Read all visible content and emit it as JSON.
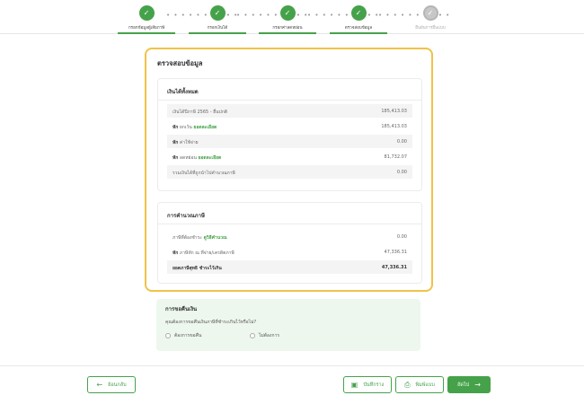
{
  "stepper": {
    "steps": [
      {
        "label": "กรอกข้อมูลผู้เสียภาษี",
        "status": "done"
      },
      {
        "label": "กรอกเงินได้",
        "status": "done"
      },
      {
        "label": "กรอกค่าลดหย่อน",
        "status": "done"
      },
      {
        "label": "ตรวจสอบข้อมูล",
        "status": "done"
      },
      {
        "label": "ยืนยันการยื่นแบบ",
        "status": "pending"
      }
    ],
    "separator": "• • • • • • • • • •"
  },
  "review": {
    "title": "ตรวจสอบข้อมูล",
    "income": {
      "title": "เงินได้ทั้งหมด",
      "rows": [
        {
          "label": "เงินได้ปีภาษี 2565 - ยื่นปกติ",
          "value": "185,413.03"
        },
        {
          "prefix": "หัก",
          "label": "ยกเว้น",
          "link": "ยอดละเอียด",
          "value": "185,413.03"
        },
        {
          "prefix": "หัก",
          "label": "ค่าใช้จ่าย",
          "value": "0.00"
        },
        {
          "prefix": "หัก",
          "label": "ลดหย่อน",
          "link": "ยอดละเอียด",
          "value": "81,732.07"
        },
        {
          "label": "รวมเงินได้ที่ถูกนำไปคำนวณภาษี",
          "value": "0.00"
        }
      ]
    },
    "tax": {
      "title": "การคำนวณภาษี",
      "rows": [
        {
          "label": "ภาษีที่ต้องชำระ",
          "link": "ดูวิธีคำนวณ",
          "value": "0.00"
        },
        {
          "prefix": "หัก",
          "label": "ภาษีหัก ณ ที่จ่าย/เครดิตภาษี",
          "value": "47,336.31"
        },
        {
          "label": "ยอดภาษีสุทธิ ชำระไว้เกิน",
          "value": "47,336.31"
        }
      ]
    }
  },
  "refund": {
    "title": "การขอคืนเงิน",
    "question": "คุณต้องการขอคืนเงินภาษีที่ชำระเกินไว้หรือไม่?",
    "options": [
      "ต้องการขอคืน",
      "ไม่ต้องการ"
    ]
  },
  "footer": {
    "back_label": "ย้อนกลับ",
    "save_label": "บันทึกร่าง",
    "print_label": "พิมพ์แบบ",
    "next_label": "ถัดไป"
  }
}
